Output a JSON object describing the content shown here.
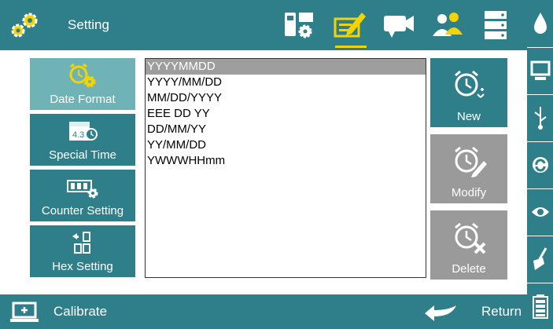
{
  "header": {
    "title": "Setting"
  },
  "toolbar": {
    "icons": [
      "device-settings-icon",
      "edit-form-icon",
      "video-camera-icon",
      "users-icon",
      "server-icon"
    ],
    "active_index": 1,
    "accent_color": "#f3d400"
  },
  "sidebar": {
    "items": [
      {
        "label": "Date Format",
        "icon": "alarm-clock-gear-icon",
        "active": true
      },
      {
        "label": "Special Time",
        "icon": "calendar-clock-icon",
        "active": false
      },
      {
        "label": "Counter Setting",
        "icon": "counter-gear-icon",
        "active": false
      },
      {
        "label": "Hex Setting",
        "icon": "hex-digits-icon",
        "active": false
      }
    ]
  },
  "formats": {
    "items": [
      "YYYYMMDD",
      "YYYY/MM/DD",
      "MM/DD/YYYY",
      "EEE DD YY",
      "DD/MM/YY",
      "YY/MM/DD",
      "YWWWHHmm"
    ],
    "selected_index": 0
  },
  "actions": {
    "new_label": "New",
    "modify_label": "Modify",
    "delete_label": "Delete"
  },
  "footer": {
    "calibrate_label": "Calibrate",
    "return_label": "Return"
  },
  "rightbar": {
    "icons": [
      "ink-drop-icon",
      "monitor-icon",
      "usb-icon",
      "refresh-icon",
      "eye-icon",
      "cleaning-brush-icon",
      "battery-icon"
    ]
  },
  "colors": {
    "primary": "#2f7f8a",
    "active": "#6fb3b6",
    "disabled": "#9a9a9a",
    "selected_row": "#9e9e9e",
    "icon_yellow": "#f3d400"
  }
}
